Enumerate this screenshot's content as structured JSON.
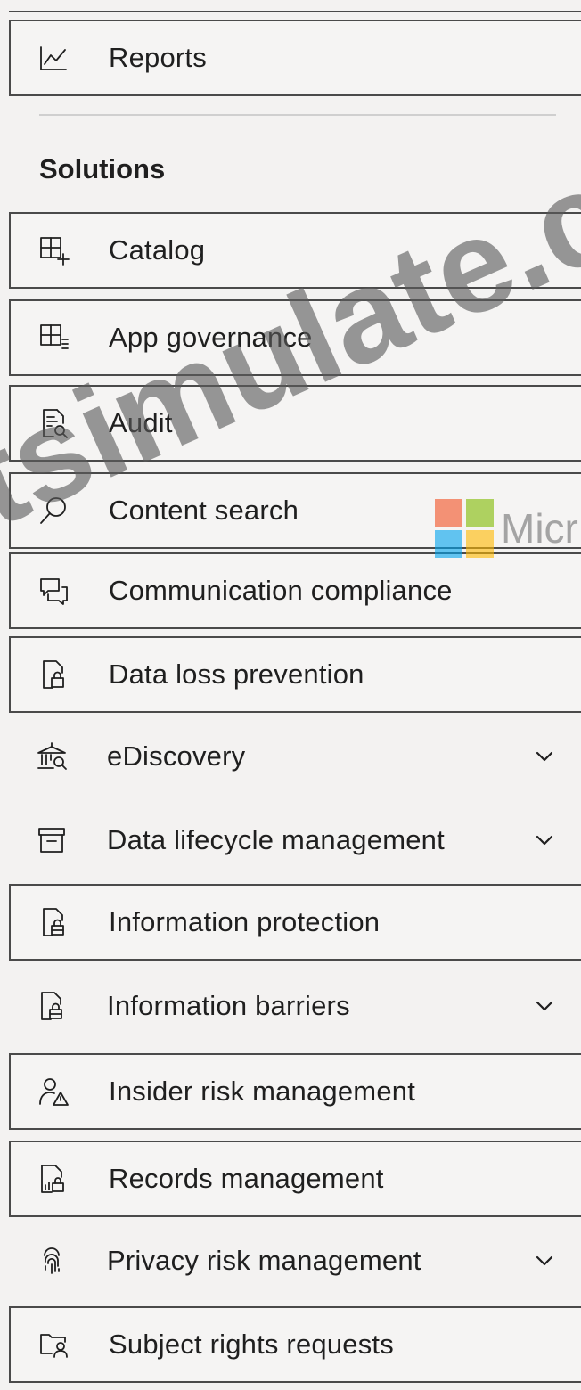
{
  "nav": {
    "reports_label": "Reports",
    "section_title": "Solutions",
    "items": [
      {
        "label": "Catalog",
        "icon": "catalog-icon",
        "has_chevron": false
      },
      {
        "label": "App governance",
        "icon": "app-governance-icon",
        "has_chevron": false
      },
      {
        "label": "Audit",
        "icon": "audit-icon",
        "has_chevron": false
      },
      {
        "label": "Content search",
        "icon": "search-icon",
        "has_chevron": false
      },
      {
        "label": "Communication compliance",
        "icon": "chat-bubbles-icon",
        "has_chevron": false
      },
      {
        "label": "Data loss prevention",
        "icon": "document-lock-icon",
        "has_chevron": false
      },
      {
        "label": "eDiscovery",
        "icon": "building-search-icon",
        "has_chevron": true
      },
      {
        "label": "Data lifecycle management",
        "icon": "archive-box-icon",
        "has_chevron": true
      },
      {
        "label": "Information protection",
        "icon": "document-lock-icon",
        "has_chevron": false
      },
      {
        "label": "Information barriers",
        "icon": "document-lock-icon",
        "has_chevron": true
      },
      {
        "label": "Insider risk management",
        "icon": "person-warning-icon",
        "has_chevron": false
      },
      {
        "label": "Records management",
        "icon": "records-icon",
        "has_chevron": false
      },
      {
        "label": "Privacy risk management",
        "icon": "fingerprint-icon",
        "has_chevron": true
      },
      {
        "label": "Subject rights requests",
        "icon": "folder-person-icon",
        "has_chevron": false
      }
    ]
  },
  "brand": {
    "partial_text": "Micr",
    "colors": [
      "#f25022",
      "#7fba00",
      "#00a4ef",
      "#ffb900"
    ]
  },
  "watermark_text": "tsimulate.c"
}
